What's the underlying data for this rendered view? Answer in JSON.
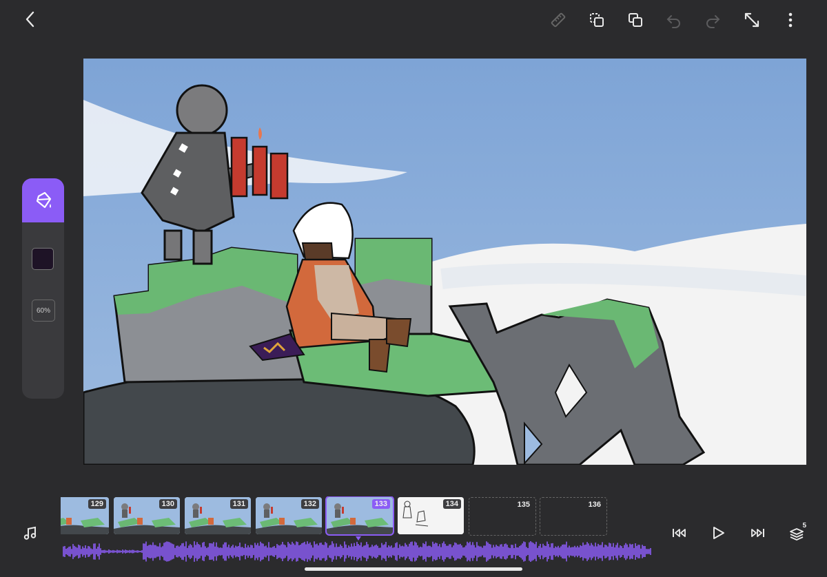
{
  "toolbar": {
    "icons": [
      "back-icon",
      "ruler-icon",
      "copy-selection-icon",
      "duplicate-icon",
      "undo-icon",
      "redo-icon",
      "fullscreen-icon",
      "more-icon"
    ]
  },
  "left_panel": {
    "active_tool": "paint-bucket",
    "color": "#1e1326",
    "accent": "#8b5cf6",
    "opacity_label": "60%"
  },
  "timeline": {
    "frames": [
      {
        "number": "129",
        "state": "filled"
      },
      {
        "number": "130",
        "state": "filled"
      },
      {
        "number": "131",
        "state": "filled"
      },
      {
        "number": "132",
        "state": "filled"
      },
      {
        "number": "133",
        "state": "current"
      },
      {
        "number": "134",
        "state": "sketch"
      },
      {
        "number": "135",
        "state": "empty"
      },
      {
        "number": "136",
        "state": "empty"
      }
    ]
  },
  "playback": {
    "onion_skin_count": "5",
    "icons": [
      "music-icon",
      "skip-back-icon",
      "play-icon",
      "skip-forward-icon",
      "onion-skin-icon"
    ]
  }
}
